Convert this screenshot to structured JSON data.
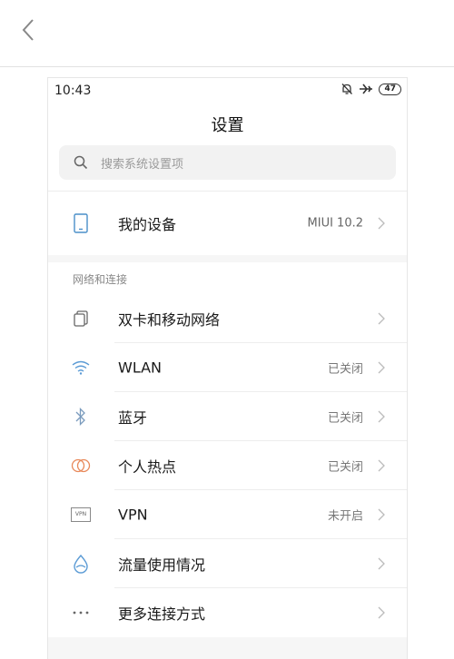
{
  "phone": {
    "time": "10:43",
    "battery": "47",
    "title": "设置",
    "search_placeholder": "搜索系统设置项",
    "device": {
      "label": "我的设备",
      "value": "MIUI 10.2"
    },
    "section_network": "网络和连接",
    "items": [
      {
        "label": "双卡和移动网络",
        "value": "",
        "icon": "sim-icon"
      },
      {
        "label": "WLAN",
        "value": "已关闭",
        "icon": "wifi-icon"
      },
      {
        "label": "蓝牙",
        "value": "已关闭",
        "icon": "bluetooth-icon"
      },
      {
        "label": "个人热点",
        "value": "已关闭",
        "icon": "hotspot-icon"
      },
      {
        "label": "VPN",
        "value": "未开启",
        "icon": "vpn-icon"
      },
      {
        "label": "流量使用情况",
        "value": "",
        "icon": "data-usage-icon"
      },
      {
        "label": "更多连接方式",
        "value": "",
        "icon": "more-icon"
      }
    ],
    "vpn_icon_text": "VPN",
    "accent_color": "#5b9bd5",
    "hotspot_color": "#e8895a"
  }
}
